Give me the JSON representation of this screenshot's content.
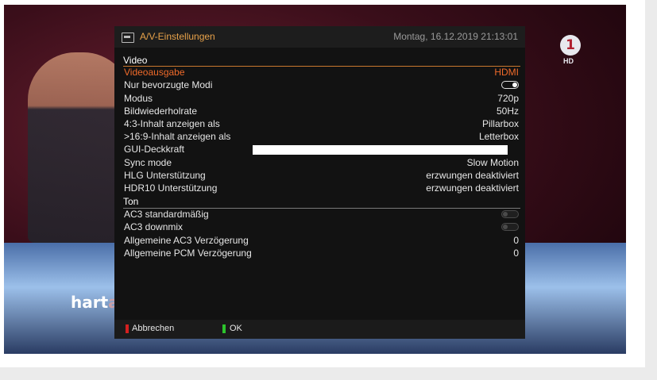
{
  "header": {
    "title": "A/V-Einstellungen",
    "datetime": "Montag, 16.12.2019 21:13:01"
  },
  "background": {
    "show_logo_text": "hart",
    "show_logo_partial": "a",
    "channel_number": "1",
    "channel_badge": "HD"
  },
  "sections": {
    "video": "Video",
    "ton": "Ton"
  },
  "video_rows": [
    {
      "label": "Videoausgabe",
      "value": "HDMI"
    },
    {
      "label": "Nur bevorzugte Modi"
    },
    {
      "label": "Modus",
      "value": "720p"
    },
    {
      "label": "Bildwiederholrate",
      "value": "50Hz"
    },
    {
      "label": "4:3-Inhalt anzeigen als",
      "value": "Pillarbox"
    },
    {
      "label": ">16:9-Inhalt anzeigen als",
      "value": "Letterbox"
    },
    {
      "label": "GUI-Deckkraft",
      "level": 1.0
    },
    {
      "label": "Sync mode",
      "value": "Slow Motion"
    },
    {
      "label": "HLG Unterstützung",
      "value": "erzwungen deaktiviert"
    },
    {
      "label": "HDR10 Unterstützung",
      "value": "erzwungen deaktiviert"
    }
  ],
  "ton_rows": [
    {
      "label": "AC3 standardmäßig"
    },
    {
      "label": "AC3 downmix"
    },
    {
      "label": "Allgemeine AC3 Verzögerung",
      "value": "0"
    },
    {
      "label": "Allgemeine PCM Verzögerung",
      "value": "0"
    }
  ],
  "footer": {
    "cancel": "Abbrechen",
    "ok": "OK"
  },
  "colors": {
    "accent": "#ef6a2a",
    "title": "#e8a24a",
    "red_key": "#d42020",
    "green_key": "#2cc42c"
  }
}
